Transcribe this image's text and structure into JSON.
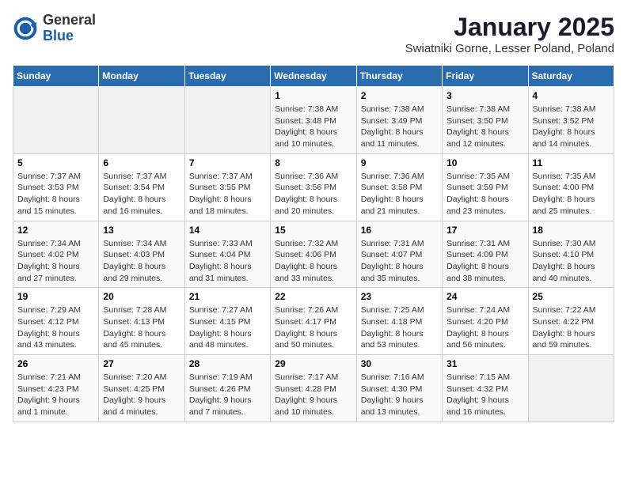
{
  "header": {
    "logo_general": "General",
    "logo_blue": "Blue",
    "month_title": "January 2025",
    "location": "Swiatniki Gorne, Lesser Poland, Poland"
  },
  "days_of_week": [
    "Sunday",
    "Monday",
    "Tuesday",
    "Wednesday",
    "Thursday",
    "Friday",
    "Saturday"
  ],
  "weeks": [
    {
      "cells": [
        {
          "day": null,
          "info": null
        },
        {
          "day": null,
          "info": null
        },
        {
          "day": null,
          "info": null
        },
        {
          "day": "1",
          "info": "Sunrise: 7:38 AM\nSunset: 3:48 PM\nDaylight: 8 hours\nand 10 minutes."
        },
        {
          "day": "2",
          "info": "Sunrise: 7:38 AM\nSunset: 3:49 PM\nDaylight: 8 hours\nand 11 minutes."
        },
        {
          "day": "3",
          "info": "Sunrise: 7:38 AM\nSunset: 3:50 PM\nDaylight: 8 hours\nand 12 minutes."
        },
        {
          "day": "4",
          "info": "Sunrise: 7:38 AM\nSunset: 3:52 PM\nDaylight: 8 hours\nand 14 minutes."
        }
      ]
    },
    {
      "cells": [
        {
          "day": "5",
          "info": "Sunrise: 7:37 AM\nSunset: 3:53 PM\nDaylight: 8 hours\nand 15 minutes."
        },
        {
          "day": "6",
          "info": "Sunrise: 7:37 AM\nSunset: 3:54 PM\nDaylight: 8 hours\nand 16 minutes."
        },
        {
          "day": "7",
          "info": "Sunrise: 7:37 AM\nSunset: 3:55 PM\nDaylight: 8 hours\nand 18 minutes."
        },
        {
          "day": "8",
          "info": "Sunrise: 7:36 AM\nSunset: 3:56 PM\nDaylight: 8 hours\nand 20 minutes."
        },
        {
          "day": "9",
          "info": "Sunrise: 7:36 AM\nSunset: 3:58 PM\nDaylight: 8 hours\nand 21 minutes."
        },
        {
          "day": "10",
          "info": "Sunrise: 7:35 AM\nSunset: 3:59 PM\nDaylight: 8 hours\nand 23 minutes."
        },
        {
          "day": "11",
          "info": "Sunrise: 7:35 AM\nSunset: 4:00 PM\nDaylight: 8 hours\nand 25 minutes."
        }
      ]
    },
    {
      "cells": [
        {
          "day": "12",
          "info": "Sunrise: 7:34 AM\nSunset: 4:02 PM\nDaylight: 8 hours\nand 27 minutes."
        },
        {
          "day": "13",
          "info": "Sunrise: 7:34 AM\nSunset: 4:03 PM\nDaylight: 8 hours\nand 29 minutes."
        },
        {
          "day": "14",
          "info": "Sunrise: 7:33 AM\nSunset: 4:04 PM\nDaylight: 8 hours\nand 31 minutes."
        },
        {
          "day": "15",
          "info": "Sunrise: 7:32 AM\nSunset: 4:06 PM\nDaylight: 8 hours\nand 33 minutes."
        },
        {
          "day": "16",
          "info": "Sunrise: 7:31 AM\nSunset: 4:07 PM\nDaylight: 8 hours\nand 35 minutes."
        },
        {
          "day": "17",
          "info": "Sunrise: 7:31 AM\nSunset: 4:09 PM\nDaylight: 8 hours\nand 38 minutes."
        },
        {
          "day": "18",
          "info": "Sunrise: 7:30 AM\nSunset: 4:10 PM\nDaylight: 8 hours\nand 40 minutes."
        }
      ]
    },
    {
      "cells": [
        {
          "day": "19",
          "info": "Sunrise: 7:29 AM\nSunset: 4:12 PM\nDaylight: 8 hours\nand 43 minutes."
        },
        {
          "day": "20",
          "info": "Sunrise: 7:28 AM\nSunset: 4:13 PM\nDaylight: 8 hours\nand 45 minutes."
        },
        {
          "day": "21",
          "info": "Sunrise: 7:27 AM\nSunset: 4:15 PM\nDaylight: 8 hours\nand 48 minutes."
        },
        {
          "day": "22",
          "info": "Sunrise: 7:26 AM\nSunset: 4:17 PM\nDaylight: 8 hours\nand 50 minutes."
        },
        {
          "day": "23",
          "info": "Sunrise: 7:25 AM\nSunset: 4:18 PM\nDaylight: 8 hours\nand 53 minutes."
        },
        {
          "day": "24",
          "info": "Sunrise: 7:24 AM\nSunset: 4:20 PM\nDaylight: 8 hours\nand 56 minutes."
        },
        {
          "day": "25",
          "info": "Sunrise: 7:22 AM\nSunset: 4:22 PM\nDaylight: 8 hours\nand 59 minutes."
        }
      ]
    },
    {
      "cells": [
        {
          "day": "26",
          "info": "Sunrise: 7:21 AM\nSunset: 4:23 PM\nDaylight: 9 hours\nand 1 minute."
        },
        {
          "day": "27",
          "info": "Sunrise: 7:20 AM\nSunset: 4:25 PM\nDaylight: 9 hours\nand 4 minutes."
        },
        {
          "day": "28",
          "info": "Sunrise: 7:19 AM\nSunset: 4:26 PM\nDaylight: 9 hours\nand 7 minutes."
        },
        {
          "day": "29",
          "info": "Sunrise: 7:17 AM\nSunset: 4:28 PM\nDaylight: 9 hours\nand 10 minutes."
        },
        {
          "day": "30",
          "info": "Sunrise: 7:16 AM\nSunset: 4:30 PM\nDaylight: 9 hours\nand 13 minutes."
        },
        {
          "day": "31",
          "info": "Sunrise: 7:15 AM\nSunset: 4:32 PM\nDaylight: 9 hours\nand 16 minutes."
        },
        {
          "day": null,
          "info": null
        }
      ]
    }
  ]
}
